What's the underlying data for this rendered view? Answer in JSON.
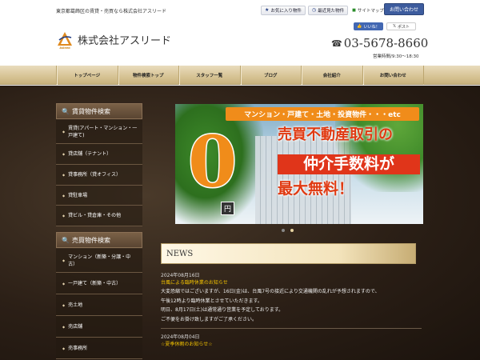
{
  "header": {
    "tagline": "東京都葛飾区の賃貸・売買なら株式会社アスリード",
    "favorites_label": "お気に入り物件",
    "recent_label": "最近見た物件",
    "sitemap_label": "サイトマップ",
    "contact_label": "お問い合わせ",
    "logo_text": "Asleed",
    "company_name": "株式会社アスリード",
    "facebook_label": "いいね！",
    "twitter_label": "ポスト",
    "phone": "03-5678-8660",
    "hours": "営業時間/9:30～18:30"
  },
  "nav": {
    "items": [
      "トップページ",
      "物件検索トップ",
      "スタッフ一覧",
      "ブログ",
      "会社紹介",
      "お問い合わせ"
    ]
  },
  "sidebar": {
    "rental": {
      "heading": "賃貸物件検索",
      "items": [
        "賃貸(アパート・マンション・一戸建て)",
        "貸店舗（テナント）",
        "貸事務所（貸オフィス）",
        "貸駐車場",
        "貸ビル・貸倉庫・その他"
      ]
    },
    "sale": {
      "heading": "売買物件検索",
      "items": [
        "マンション（新築・分譲・中古）",
        "一戸建て（新築・中古）",
        "売土地",
        "売店舗",
        "売事務所"
      ]
    }
  },
  "banner": {
    "top_text": "マンション・戸建て・土地・投資物件・・・etc",
    "zero": "0",
    "yen": "円",
    "line1": "売買不動産取引の",
    "line2": "仲介手数料が",
    "line3": "最大無料！"
  },
  "slider": {
    "slide_count": 2,
    "active_index": 1
  },
  "news": {
    "heading": "NEWS",
    "entries": [
      {
        "date": "2024年08月16日",
        "title": "台風による臨時休業のお知らせ",
        "body": [
          "大変恐縮ではございますが、16日(金)は、台風7号の接近により交通機関の乱れが予想されますので、",
          "午後12時より臨時休業とさせていただきます。",
          "明日、8月17日(土)は通常通り営業を予定しております。",
          "ご不便をお掛け致しますがご了承ください。"
        ]
      },
      {
        "date": "2024年08月04日",
        "title": "☆夏季休暇のお知らせ☆"
      }
    ]
  },
  "colors": {
    "nav_gold": "#d8c597",
    "banner_orange": "#f08c1a",
    "banner_red": "#e0351a",
    "news_title_yellow": "#f2c200",
    "contact_blue": "#3d5c9e"
  }
}
